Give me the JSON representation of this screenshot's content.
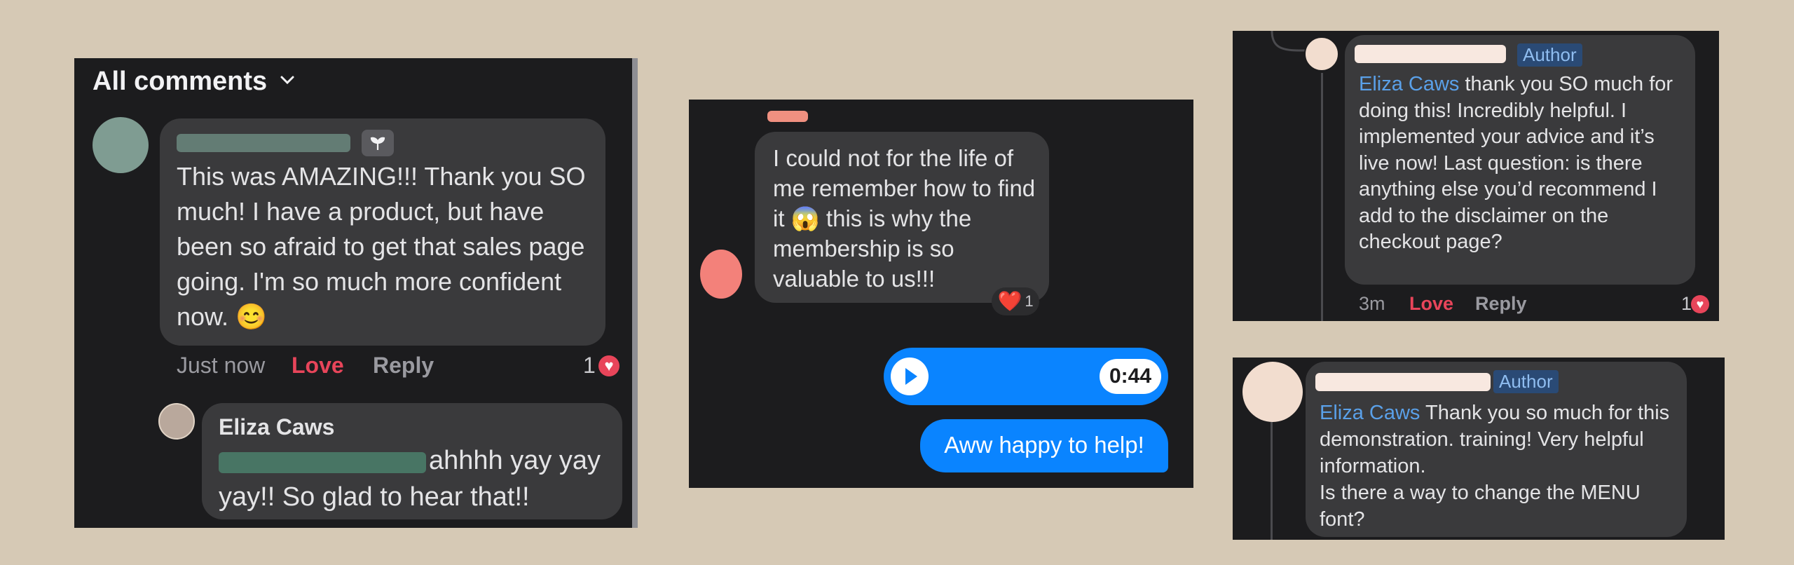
{
  "panel1": {
    "header": "All comments",
    "chevron_icon": "chevron-down-icon",
    "comment": {
      "text": "This was AMAZING!!! Thank you SO much! I have a product, but have been so afraid to get that sales page going. I'm so much more confident now. 😊",
      "time": "Just now",
      "love": "Love",
      "reply": "Reply",
      "reaction_count": "1"
    },
    "reply": {
      "author": "Eliza Caws",
      "text": "ahhhh yay yay yay!! So glad to hear that!!"
    }
  },
  "panel2": {
    "received_message": "I could not for the life of me remember how to find it 😱 this is why the membership is so valuable to us!!!",
    "reaction_emoji": "❤️",
    "reaction_count": "1",
    "audio_duration": "0:44",
    "sent_message": "Aww happy to help!"
  },
  "panel3": {
    "badge": "Author",
    "mention": "Eliza Caws",
    "text": "thank you SO much for doing this! Incredibly helpful. I implemented your advice and it’s live now! Last question: is there anything else you’d recommend I add to the disclaimer on the checkout page?",
    "time": "3m",
    "love": "Love",
    "reply": "Reply",
    "reaction_count": "1"
  },
  "panel4": {
    "badge": "Author",
    "mention": "Eliza Caws",
    "text_line1": "Thank you so much for this demonstration. training! Very helpful information.",
    "text_line2": "Is there a way to change the MENU font?"
  },
  "colors": {
    "background": "#d6c9b5",
    "panel": "#1c1c1e",
    "bubble": "#3a3a3c",
    "accent_blue": "#0a84ff",
    "mention_blue": "#5aa0e8",
    "love_red": "#e8455a"
  }
}
